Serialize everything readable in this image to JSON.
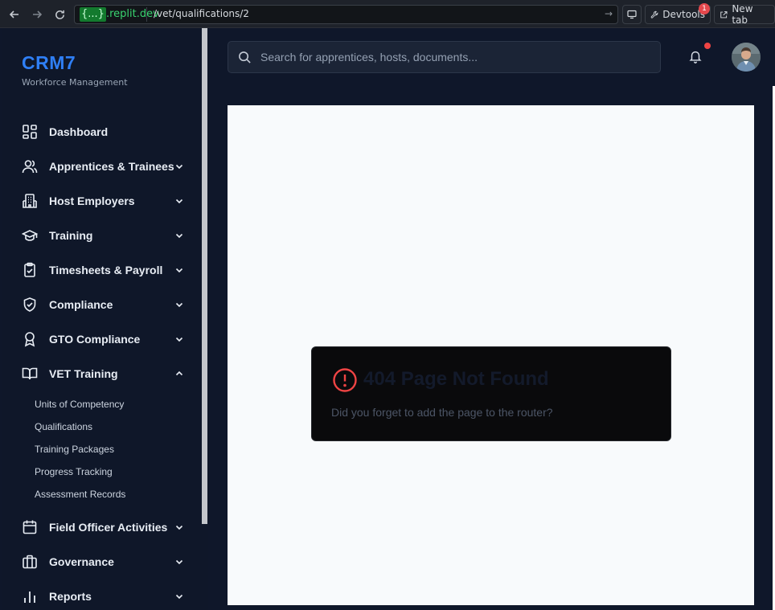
{
  "browser": {
    "domain_badge": "{...}",
    "domain_rest": ".replit.dev",
    "url_path": "/vet/qualifications/2",
    "devtools_label": "Devtools",
    "devtools_count": "1",
    "newtab_label": "New tab"
  },
  "sidebar": {
    "brand": "CRM7",
    "brand_sub": "Workforce Management",
    "items": [
      {
        "label": "Dashboard",
        "icon": "dashboard-icon",
        "expandable": false
      },
      {
        "label": "Apprentices & Trainees",
        "icon": "users-icon",
        "expandable": true
      },
      {
        "label": "Host Employers",
        "icon": "building-icon",
        "expandable": true
      },
      {
        "label": "Training",
        "icon": "graduation-cap-icon",
        "expandable": true
      },
      {
        "label": "Timesheets & Payroll",
        "icon": "clipboard-check-icon",
        "expandable": true
      },
      {
        "label": "Compliance",
        "icon": "shield-check-icon",
        "expandable": true
      },
      {
        "label": "GTO Compliance",
        "icon": "award-icon",
        "expandable": true
      },
      {
        "label": "VET Training",
        "icon": "book-open-icon",
        "expandable": true,
        "expanded": true
      },
      {
        "label": "Field Officer Activities",
        "icon": "calendar-icon",
        "expandable": true
      },
      {
        "label": "Governance",
        "icon": "briefcase-icon",
        "expandable": true
      },
      {
        "label": "Reports",
        "icon": "bar-chart-icon",
        "expandable": true
      }
    ],
    "vet_sub_items": [
      "Units of Competency",
      "Qualifications",
      "Training Packages",
      "Progress Tracking",
      "Assessment Records"
    ]
  },
  "header": {
    "search_placeholder": "Search for apprentices, hosts, documents..."
  },
  "error_card": {
    "title": "404 Page Not Found",
    "message": "Did you forget to add the page to the router?"
  },
  "colors": {
    "brand": "#2f7ff5",
    "error": "#ef4444",
    "sidebar_bg": "#0f1729"
  }
}
